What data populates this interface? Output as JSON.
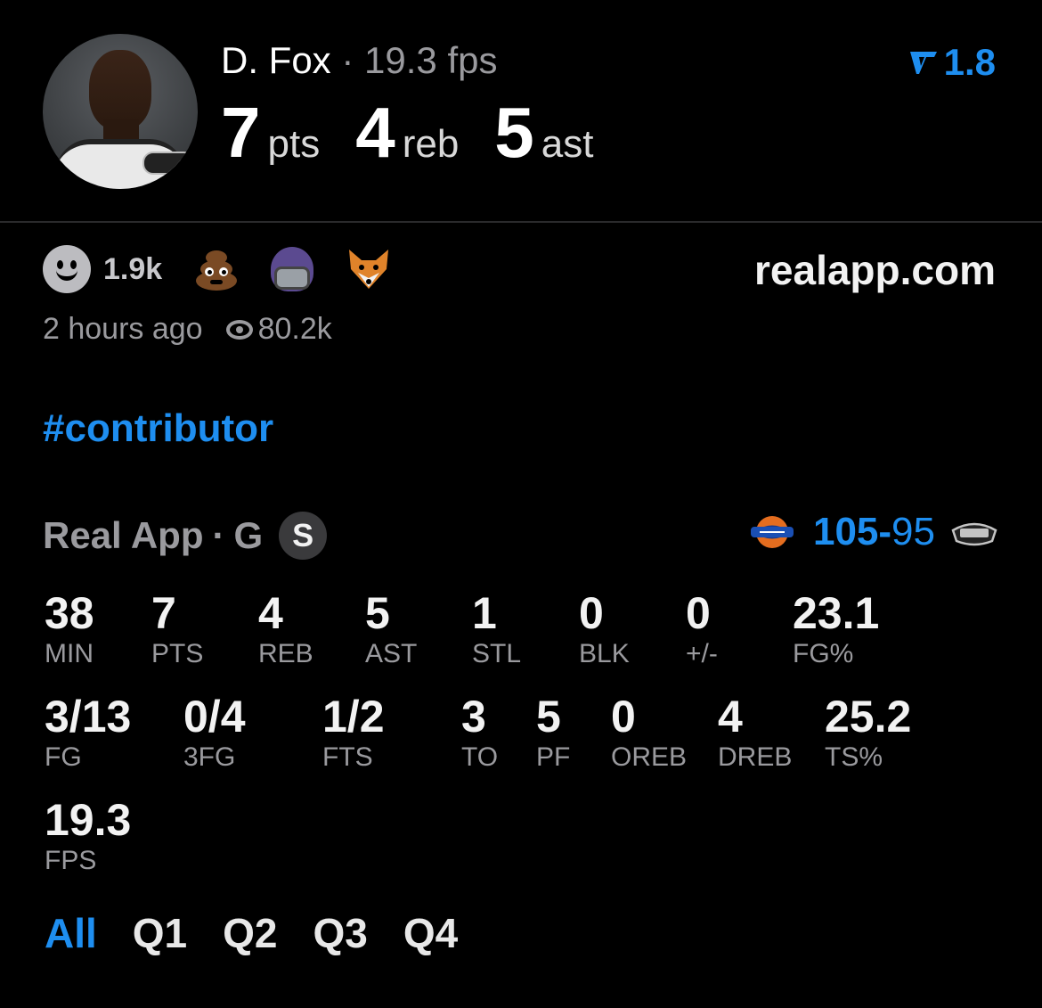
{
  "player": {
    "name": "D. Fox",
    "separator": "·",
    "fps_label": "19.3 fps",
    "pts_value": "7",
    "pts_unit": "pts",
    "reb_value": "4",
    "reb_unit": "reb",
    "ast_value": "5",
    "ast_unit": "ast"
  },
  "rating": {
    "value": "1.8",
    "icon": "real-logo-icon"
  },
  "reactions": {
    "count": "1.9k",
    "icons": [
      "smile-icon",
      "poop-emoji",
      "helmet-emoji",
      "fox-emoji"
    ]
  },
  "site": "realapp.com",
  "meta": {
    "time": "2 hours ago",
    "views": "80.2k"
  },
  "hashtag": "#contributor",
  "game": {
    "league": "Real App",
    "separator": "·",
    "position": "G",
    "badge": "S",
    "away_score": "105",
    "dash": "-",
    "home_score": "95",
    "away_team_icon": "knicks-logo",
    "home_team_icon": "spurs-logo"
  },
  "stats_row1": [
    {
      "v": "38",
      "l": "MIN"
    },
    {
      "v": "7",
      "l": "PTS"
    },
    {
      "v": "4",
      "l": "REB"
    },
    {
      "v": "5",
      "l": "AST"
    },
    {
      "v": "1",
      "l": "STL"
    },
    {
      "v": "0",
      "l": "BLK"
    },
    {
      "v": "0",
      "l": "+/-"
    },
    {
      "v": "23.1",
      "l": "FG%"
    }
  ],
  "stats_row2": [
    {
      "v": "3/13",
      "l": "FG"
    },
    {
      "v": "0/4",
      "l": "3FG"
    },
    {
      "v": "1/2",
      "l": "FTS"
    },
    {
      "v": "3",
      "l": "TO"
    },
    {
      "v": "5",
      "l": "PF"
    },
    {
      "v": "0",
      "l": "OREB"
    },
    {
      "v": "4",
      "l": "DREB"
    },
    {
      "v": "25.2",
      "l": "TS%"
    }
  ],
  "stats_row3": [
    {
      "v": "19.3",
      "l": "FPS"
    }
  ],
  "tabs": [
    "All",
    "Q1",
    "Q2",
    "Q3",
    "Q4"
  ],
  "colors": {
    "accent": "#1e8ef0",
    "muted": "#9a9a9e",
    "background": "#000000"
  }
}
